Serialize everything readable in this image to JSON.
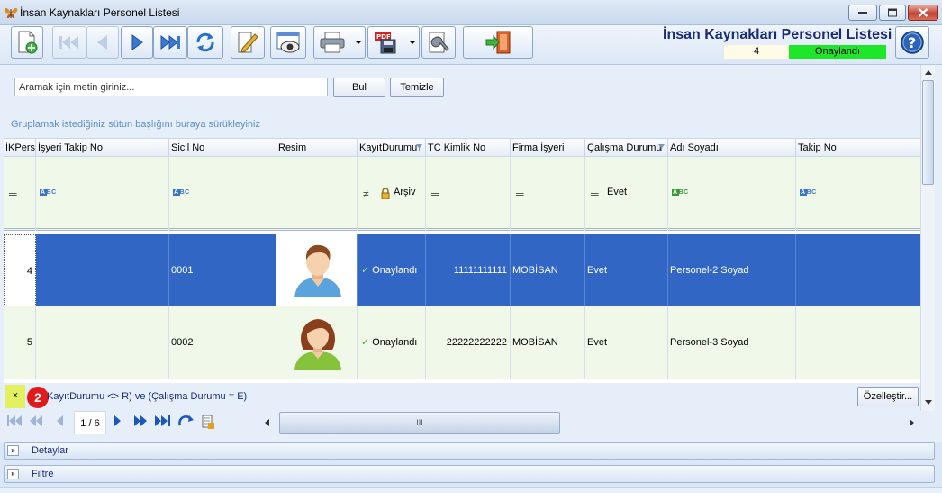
{
  "window": {
    "title": "İnsan Kaynakları Personel Listesi"
  },
  "header": {
    "title": "İnsan Kaynakları Personel Listesi",
    "record_count": "4",
    "record_status": "Onaylandı",
    "status_color": "#1ee628"
  },
  "search": {
    "placeholder": "Aramak için metin giriniz...",
    "find_label": "Bul",
    "clear_label": "Temizle"
  },
  "grid": {
    "group_hint": "Gruplamak istediğiniz sütun başlığını buraya sürükleyiniz",
    "columns": [
      "İKPers",
      "İşyeri Takip No",
      "Sicil No",
      "Resim",
      "KayıtDurumu",
      "TC Kimlik No",
      "Firma İşyeri",
      "Çalışma Durumu",
      "Adı Soyadı",
      "Takip No"
    ],
    "filter_row": {
      "kayit_durumu": "Arşiv",
      "calisma_durumu": "Evet"
    },
    "rows": [
      {
        "id": "4",
        "isyeri_takip_no": "",
        "sicil_no": "0001",
        "kayit_durumu": "Onaylandı",
        "tc_kimlik_no": "11111111111",
        "firma_isyeri": "MOBİSAN",
        "calisma_durumu": "Evet",
        "adi_soyadi": "Personel-2 Soyad",
        "takip_no": ""
      },
      {
        "id": "5",
        "isyeri_takip_no": "",
        "sicil_no": "0002",
        "kayit_durumu": "Onaylandı",
        "tc_kimlik_no": "22222222222",
        "firma_isyeri": "MOBİSAN",
        "calisma_durumu": "Evet",
        "adi_soyadi": "Personel-3 Soyad",
        "takip_no": ""
      }
    ]
  },
  "filter_bar": {
    "close": "×",
    "badge": "2",
    "text": "KayıtDurumu <> R) ve (Çalışma Durumu = E)",
    "customize_label": "Özelleştir..."
  },
  "navigator": {
    "page_indicator": "1 / 6",
    "scroll_grip": "III"
  },
  "panels": {
    "details_label": "Detaylar",
    "filter_label": "Filtre"
  },
  "colors": {
    "selection": "#3166c5",
    "header_text": "#1a2b7a"
  }
}
